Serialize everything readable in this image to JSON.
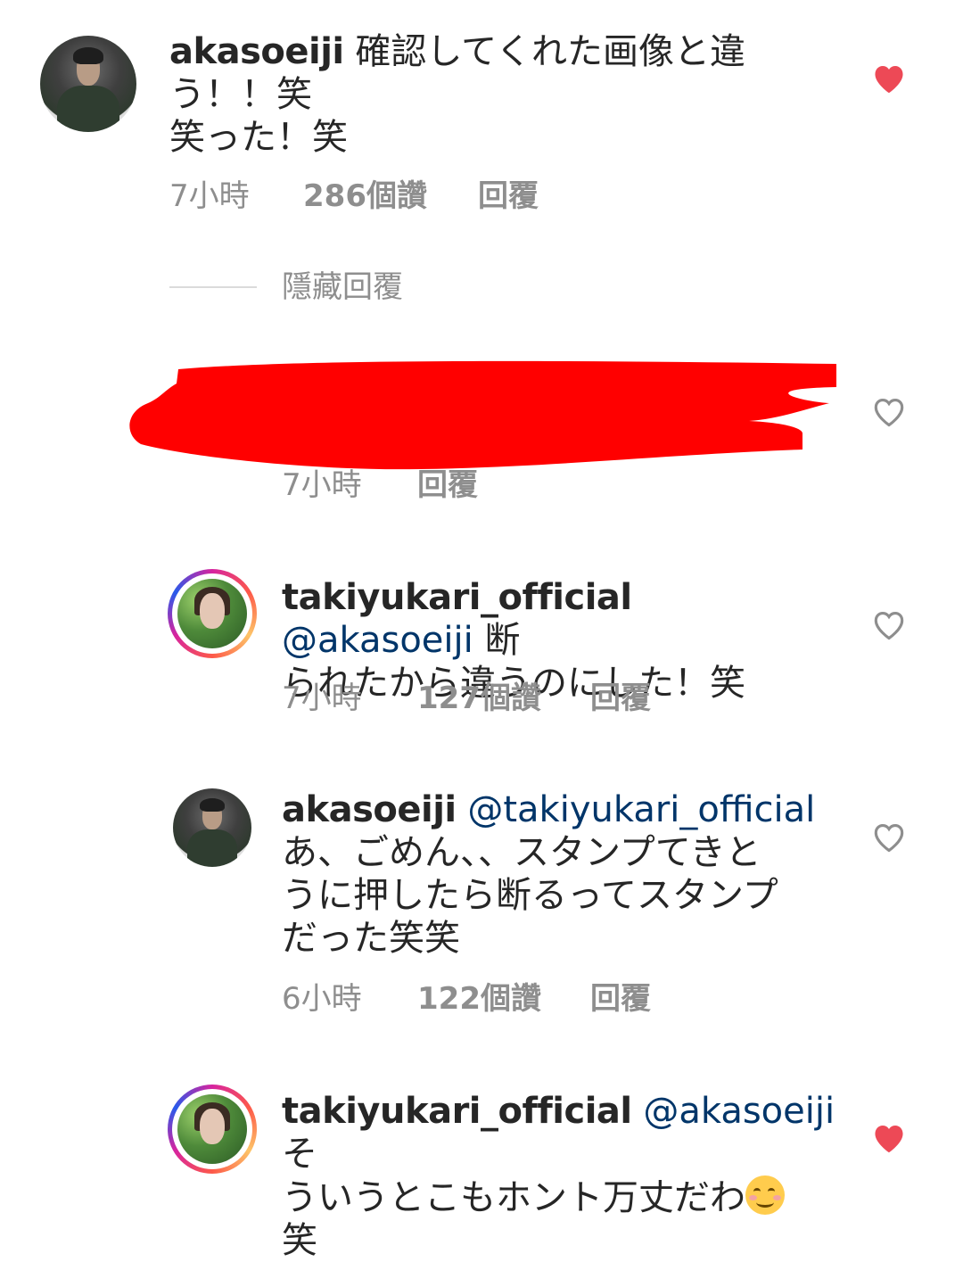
{
  "comments": [
    {
      "username": "akasoeiji",
      "mention": "",
      "text_line1": "確認してくれた画像と違",
      "text_line2": "う！！笑",
      "text_line3": "笑った！笑",
      "time": "7小時",
      "likes": "286個讚",
      "reply": "回覆",
      "liked": true
    },
    {
      "toggle_label": "隱藏回覆"
    },
    {
      "time": "7小時",
      "reply": "回覆",
      "liked": false
    },
    {
      "username": "takiyukari_official",
      "mention": "@akasoeiji",
      "text_inline": "断",
      "text_line2": "られたから違うのにした！笑",
      "time": "7小時",
      "likes": "127個讚",
      "reply": "回覆",
      "liked": false
    },
    {
      "username": "akasoeiji",
      "mention": "@takiyukari_official",
      "text_line2": "あ、ごめん、、スタンプてきと",
      "text_line3": "うに押したら断るってスタンプ",
      "text_line4": "だった笑笑",
      "time": "6小時",
      "likes": "122個讚",
      "reply": "回覆",
      "liked": false
    },
    {
      "username": "takiyukari_official",
      "mention": "@akasoeiji",
      "text_inline": "そ",
      "text_line2": "ういうとこもホント万丈だわ",
      "emoji": "smiling-face-icon",
      "text_line3": "笑",
      "liked": true
    }
  ],
  "colors": {
    "heart_liked": "#ed4956",
    "heart_outline": "#8e8e8e",
    "mention": "#003569",
    "meta": "#8e8e8e",
    "redaction": "#ff0000"
  }
}
